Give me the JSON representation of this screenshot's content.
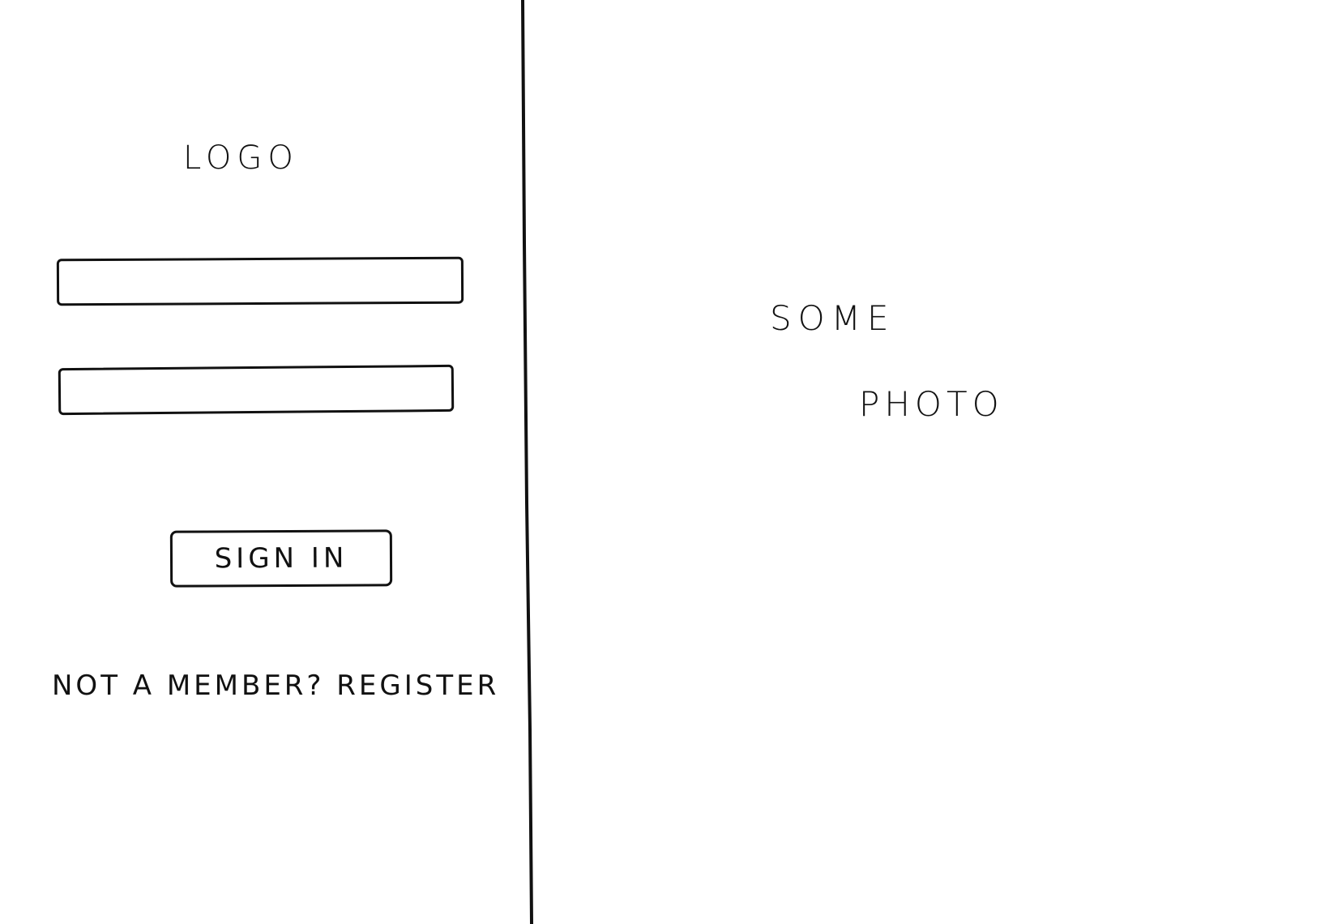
{
  "login": {
    "logo_text": "LOGO",
    "field_1_value": "",
    "field_2_value": "",
    "signin_label": "SIGN IN",
    "register_prompt": "NOT A MEMBER?",
    "register_link": "REGISTER"
  },
  "photo_placeholder": {
    "line_1": "SOME",
    "line_2": "PHOTO"
  },
  "colors": {
    "ink": "#111111",
    "background": "#ffffff"
  }
}
